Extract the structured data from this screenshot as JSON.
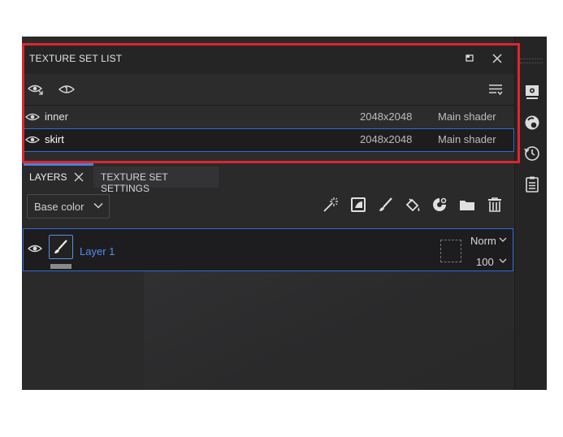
{
  "texture_set_list": {
    "title": "TEXTURE SET LIST",
    "rows": [
      {
        "name": "inner",
        "resolution": "2048x2048",
        "shader": "Main shader"
      },
      {
        "name": "skirt",
        "resolution": "2048x2048",
        "shader": "Main shader"
      }
    ],
    "selected_row": "skirt"
  },
  "tabs": {
    "layers": "LAYERS",
    "texture_set_settings": "TEXTURE SET SETTINGS"
  },
  "layers_toolbar": {
    "channel_select": "Base color"
  },
  "layer": {
    "name": "Layer 1",
    "blend_mode": "Norm",
    "opacity": "100"
  },
  "colors": {
    "selection_outline": "#2f6bd0",
    "layer_name": "#4f8ff0",
    "annotation_box": "#e0242b"
  }
}
